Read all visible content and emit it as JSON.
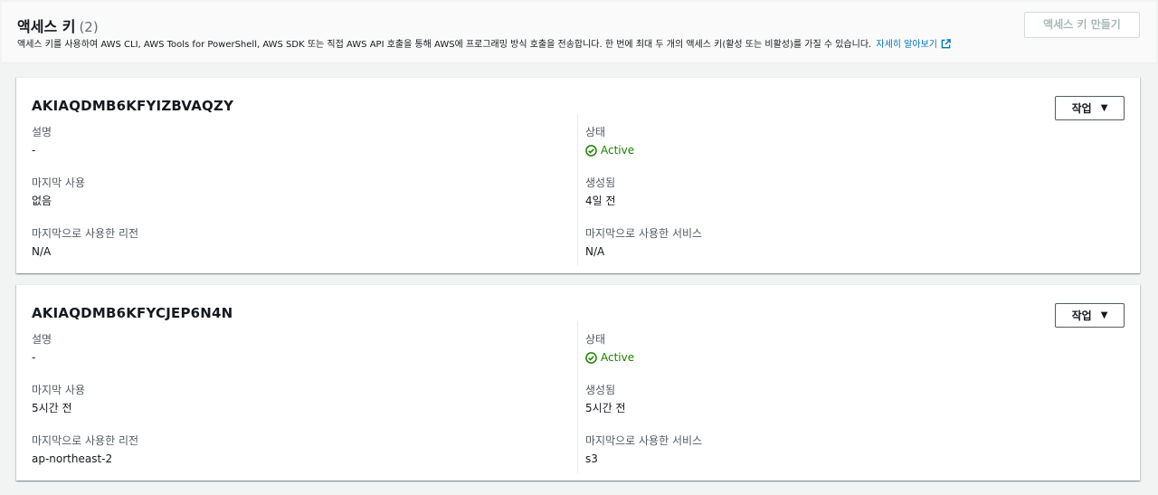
{
  "header": {
    "title": "액세스 키",
    "count": "(2)",
    "description": "액세스 키를 사용하여 AWS CLI, AWS Tools for PowerShell, AWS SDK 또는 직접 AWS API 호출을 통해 AWS에 프로그래밍 방식 호출을 전송합니다. 한 번에 최대 두 개의 액세스 키(활성 또는 비활성)를 가질 수 있습니다.",
    "learn_more": "자세히 알아보기",
    "create_button": "액세스 키 만들기"
  },
  "colors": {
    "accent_link": "#0073bb",
    "status_active": "#1d8102",
    "disabled_text": "#aab7b8"
  },
  "icons": [
    "external-link-icon",
    "caret-down-icon",
    "check-circle-icon"
  ],
  "keys": [
    {
      "id": "AKIAQDMB6KFYIZBVAQZY",
      "action_label": "작업",
      "description_label": "설명",
      "description": "-",
      "status_label": "상태",
      "status": "Active",
      "last_used_label": "마지막 사용",
      "last_used": "없음",
      "created_label": "생성됨",
      "created": "4일 전",
      "last_region_label": "마지막으로 사용한 리전",
      "last_region": "N/A",
      "last_service_label": "마지막으로 사용한 서비스",
      "last_service": "N/A"
    },
    {
      "id": "AKIAQDMB6KFYCJEP6N4N",
      "action_label": "작업",
      "description_label": "설명",
      "description": "-",
      "status_label": "상태",
      "status": "Active",
      "last_used_label": "마지막 사용",
      "last_used": "5시간 전",
      "created_label": "생성됨",
      "created": "5시간 전",
      "last_region_label": "마지막으로 사용한 리전",
      "last_region": "ap-northeast-2",
      "last_service_label": "마지막으로 사용한 서비스",
      "last_service": "s3"
    }
  ]
}
